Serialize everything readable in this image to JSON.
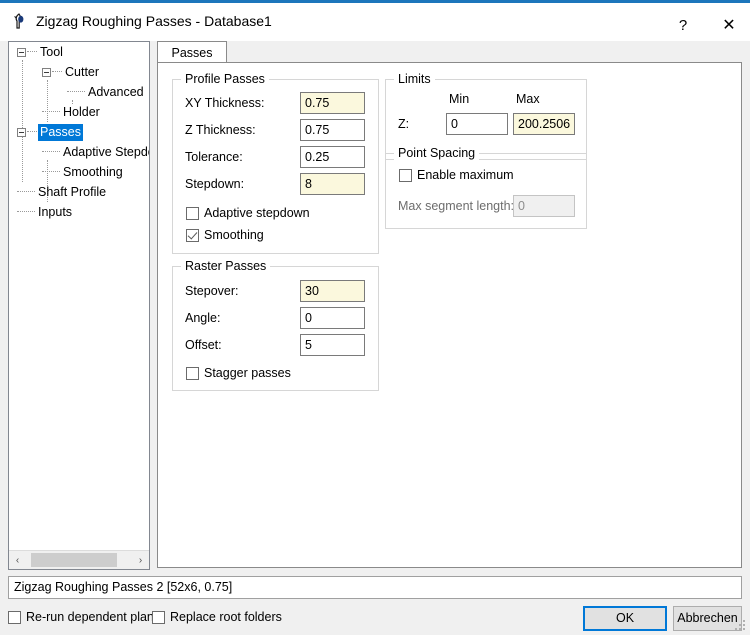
{
  "window": {
    "title": "Zigzag Roughing Passes - Database1",
    "icon": "tool-icon",
    "help_label": "?",
    "close_label": "✕"
  },
  "tree": {
    "items": [
      {
        "label": "Tool",
        "depth": 0,
        "expander": true,
        "selected": false
      },
      {
        "label": "Cutter",
        "depth": 1,
        "expander": true,
        "selected": false
      },
      {
        "label": "Advanced",
        "depth": 2,
        "expander": false,
        "selected": false
      },
      {
        "label": "Holder",
        "depth": 1,
        "expander": false,
        "selected": false
      },
      {
        "label": "Passes",
        "depth": 0,
        "expander": true,
        "selected": true
      },
      {
        "label": "Adaptive Stepdown",
        "depth": 1,
        "expander": false,
        "selected": false
      },
      {
        "label": "Smoothing",
        "depth": 1,
        "expander": false,
        "selected": false
      },
      {
        "label": "Shaft Profile",
        "depth": 0,
        "expander": false,
        "selected": false
      },
      {
        "label": "Inputs",
        "depth": 0,
        "expander": false,
        "selected": false
      }
    ],
    "scrollbar": {
      "left_arrow": "‹",
      "right_arrow": "›"
    }
  },
  "tabs": [
    {
      "label": "Passes",
      "selected": true
    }
  ],
  "profile_passes": {
    "title": "Profile Passes",
    "fields": [
      {
        "label": "XY Thickness:",
        "value": "0.75",
        "modified": true
      },
      {
        "label": "Z Thickness:",
        "value": "0.75",
        "modified": false
      },
      {
        "label": "Tolerance:",
        "value": "0.25",
        "modified": false
      },
      {
        "label": "Stepdown:",
        "value": "8",
        "modified": true
      }
    ],
    "checkboxes": [
      {
        "label": "Adaptive stepdown",
        "checked": false
      },
      {
        "label": "Smoothing",
        "checked": true
      }
    ]
  },
  "raster_passes": {
    "title": "Raster Passes",
    "fields": [
      {
        "label": "Stepover:",
        "value": "30",
        "modified": true
      },
      {
        "label": "Angle:",
        "value": "0",
        "modified": false
      },
      {
        "label": "Offset:",
        "value": "5",
        "modified": false
      }
    ],
    "checkboxes": [
      {
        "label": "Stagger passes",
        "checked": false
      }
    ]
  },
  "limits": {
    "title": "Limits",
    "col_min": "Min",
    "col_max": "Max",
    "row_label": "Z:",
    "min_value": "0",
    "max_value": "200.2506"
  },
  "point_spacing": {
    "title": "Point Spacing",
    "enable_label": "Enable maximum",
    "enable_checked": false,
    "max_segment_label": "Max segment length:",
    "max_segment_value": "0",
    "max_segment_disabled": true
  },
  "status": {
    "text": "Zigzag Roughing Passes 2 [52x6, 0.75]"
  },
  "bottom": {
    "rerun_label": "Re-run dependent plans",
    "rerun_checked": false,
    "replace_label": "Replace root folders",
    "replace_checked": false,
    "ok_label": "OK",
    "cancel_label": "Abbrechen"
  },
  "colors": {
    "accent": "#1c76bc",
    "selection": "#0078d7",
    "modified_field": "#fbf8dd",
    "dialog_bg": "#f0f0f0"
  }
}
